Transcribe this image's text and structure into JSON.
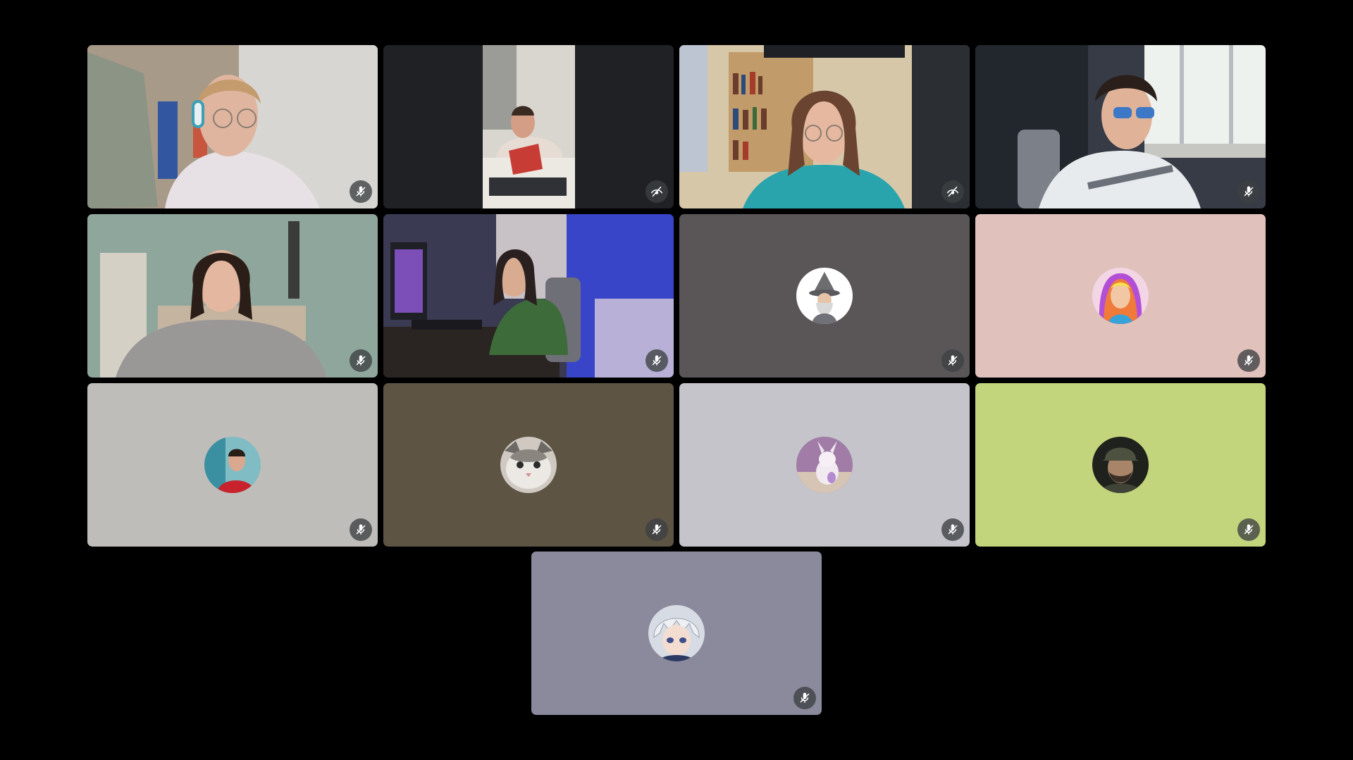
{
  "app": {
    "background_color": "#000000",
    "tile_background_colors": {
      "tile_7": "#5a5658",
      "tile_8": "#e1c1bb",
      "tile_9": "#bfbdb9",
      "tile_10": "#5d5444",
      "tile_11": "#c5c4ca",
      "tile_12": "#c2d47c",
      "tile_13": "#8b8a9c"
    }
  },
  "participants": [
    {
      "id": 1,
      "kind": "camera",
      "status_icon": "mic-off-icon"
    },
    {
      "id": 2,
      "kind": "camera",
      "status_icon": "visibility-off-icon"
    },
    {
      "id": 3,
      "kind": "camera",
      "status_icon": "visibility-off-icon"
    },
    {
      "id": 4,
      "kind": "camera",
      "status_icon": "mic-off-icon"
    },
    {
      "id": 5,
      "kind": "camera",
      "status_icon": "mic-off-icon"
    },
    {
      "id": 6,
      "kind": "camera",
      "status_icon": "mic-off-icon"
    },
    {
      "id": 7,
      "kind": "avatar",
      "avatar": "wizard-avatar",
      "status_icon": "mic-off-icon"
    },
    {
      "id": 8,
      "kind": "avatar",
      "avatar": "colorful-woman-avatar",
      "status_icon": "mic-off-icon"
    },
    {
      "id": 9,
      "kind": "avatar",
      "avatar": "man-red-shirt-avatar",
      "status_icon": "mic-off-icon"
    },
    {
      "id": 10,
      "kind": "avatar",
      "avatar": "cat-avatar",
      "status_icon": "mic-off-icon"
    },
    {
      "id": 11,
      "kind": "avatar",
      "avatar": "plush-toy-avatar",
      "status_icon": "mic-off-icon"
    },
    {
      "id": 12,
      "kind": "avatar",
      "avatar": "soldier-avatar",
      "status_icon": "mic-off-icon"
    },
    {
      "id": 13,
      "kind": "avatar",
      "avatar": "anime-boy-avatar",
      "status_icon": "mic-off-icon"
    }
  ]
}
